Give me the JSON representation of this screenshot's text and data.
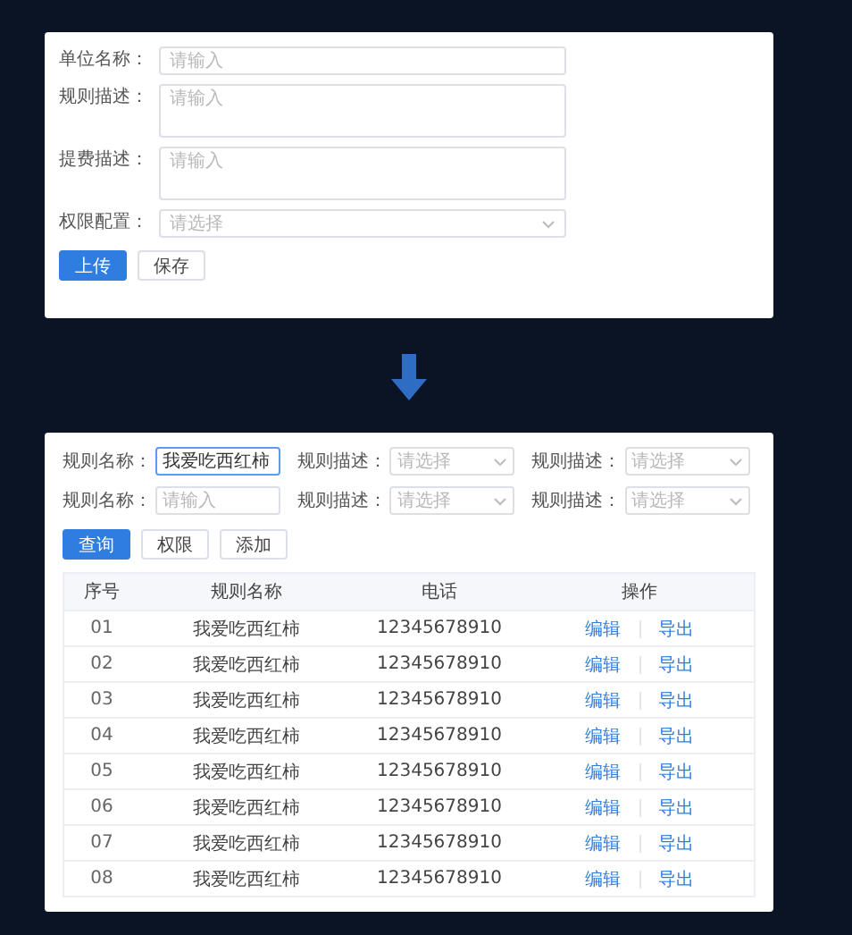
{
  "upload_form": {
    "fields": [
      {
        "kind": "input",
        "label": "单位名称：",
        "placeholder": "请输入"
      },
      {
        "kind": "textarea",
        "label": "规则描述：",
        "placeholder": "请输入"
      },
      {
        "kind": "textarea",
        "label": "提费描述：",
        "placeholder": "请输入"
      },
      {
        "kind": "select",
        "label": "权限配置：",
        "placeholder": "请选择"
      }
    ],
    "buttons": [
      {
        "label": "上传",
        "primary": true
      },
      {
        "label": "保存",
        "primary": false
      }
    ]
  },
  "query_form": {
    "filters": [
      {
        "kind": "input",
        "label": "规则名称：",
        "value": "我爱吃西红柿",
        "focused": true
      },
      {
        "kind": "select",
        "label": "规则描述：",
        "placeholder": "请选择"
      },
      {
        "kind": "select",
        "label": "规则描述：",
        "placeholder": "请选择"
      },
      {
        "kind": "input",
        "label": "规则名称：",
        "placeholder": "请输入",
        "focused": false
      },
      {
        "kind": "select",
        "label": "规则描述：",
        "placeholder": "请选择"
      },
      {
        "kind": "select",
        "label": "规则描述：",
        "placeholder": "请选择"
      }
    ],
    "buttons": [
      {
        "label": "查询",
        "primary": true
      },
      {
        "label": "权限",
        "primary": false
      },
      {
        "label": "添加",
        "primary": false
      }
    ]
  },
  "table": {
    "columns": [
      "序号",
      "规则名称",
      "电话",
      "操作"
    ],
    "rows": [
      {
        "cells": [
          "01",
          "我爱吃西红柿",
          "12345678910"
        ],
        "actions": [
          "编辑",
          "导出"
        ]
      },
      {
        "cells": [
          "02",
          "我爱吃西红柿",
          "12345678910"
        ],
        "actions": [
          "编辑",
          "导出"
        ]
      },
      {
        "cells": [
          "03",
          "我爱吃西红柿",
          "12345678910"
        ],
        "actions": [
          "编辑",
          "导出"
        ]
      },
      {
        "cells": [
          "04",
          "我爱吃西红柿",
          "12345678910"
        ],
        "actions": [
          "编辑",
          "导出"
        ]
      },
      {
        "cells": [
          "05",
          "我爱吃西红柿",
          "12345678910"
        ],
        "actions": [
          "编辑",
          "导出"
        ]
      },
      {
        "cells": [
          "06",
          "我爱吃西红柿",
          "12345678910"
        ],
        "actions": [
          "编辑",
          "导出"
        ]
      },
      {
        "cells": [
          "07",
          "我爱吃西红柿",
          "12345678910"
        ],
        "actions": [
          "编辑",
          "导出"
        ]
      },
      {
        "cells": [
          "08",
          "我爱吃西红柿",
          "12345678910"
        ],
        "actions": [
          "编辑",
          "导出"
        ]
      }
    ]
  }
}
